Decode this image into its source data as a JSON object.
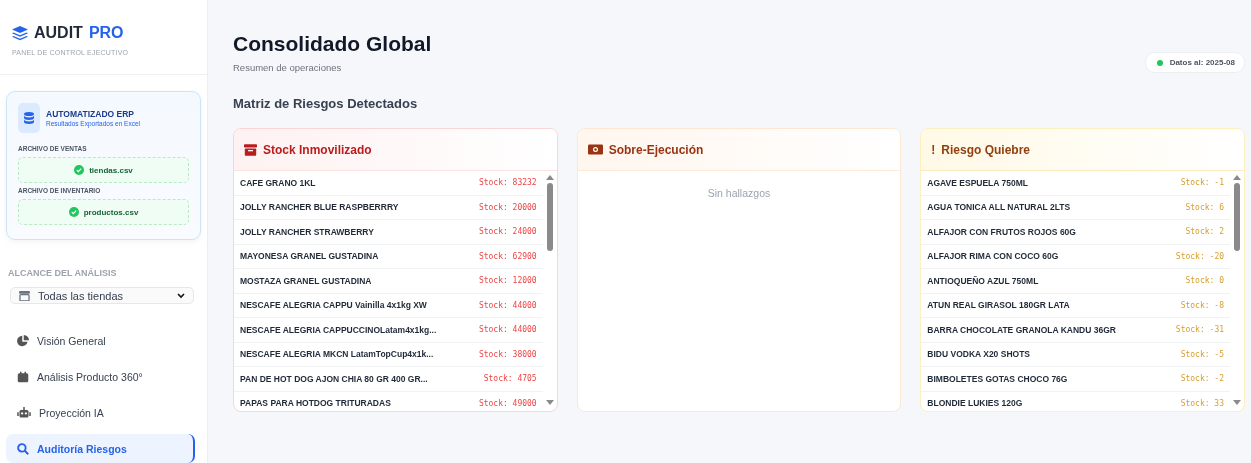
{
  "brand": {
    "name": "AUDIT",
    "accent": "PRO",
    "subtitle": "PANEL DE CONTROL EJECUTIVO"
  },
  "erp": {
    "title": "AUTOMATIZADO ERP",
    "subtitle": "Resultados Exportados en Excel",
    "files": [
      {
        "label": "ARCHIVO DE VENTAS",
        "file": "tiendas.csv"
      },
      {
        "label": "ARCHIVO DE INVENTARIO",
        "file": "productos.csv"
      }
    ]
  },
  "scope": {
    "label": "ALCANCE DEL ANÁLISIS",
    "value": "Todas las tiendas"
  },
  "nav": [
    {
      "kind": "chart",
      "label": "Visión General",
      "selected": false
    },
    {
      "kind": "calendar",
      "label": "Análisis Producto 360°",
      "selected": false
    },
    {
      "kind": "robot",
      "label": "Proyección IA",
      "selected": false
    },
    {
      "kind": "search",
      "label": "Auditoría Riesgos",
      "selected": true
    }
  ],
  "header": {
    "title": "Consolidado Global",
    "subtitle": "Resumen de operaciones",
    "badge": "Datos al: 2025-08"
  },
  "section_title": "Matriz de Riesgos Detectados",
  "panels": [
    {
      "kind": "danger",
      "title": "Stock Inmovilizado",
      "rows": [
        {
          "name": "CAFE GRANO 1KL",
          "stock": "Stock: 83232"
        },
        {
          "name": "JOLLY RANCHER BLUE RASPBERRRY",
          "stock": "Stock: 20000"
        },
        {
          "name": "JOLLY RANCHER STRAWBERRY",
          "stock": "Stock: 24000"
        },
        {
          "name": "MAYONESA GRANEL GUSTADINA",
          "stock": "Stock: 62900"
        },
        {
          "name": "MOSTAZA GRANEL GUSTADINA",
          "stock": "Stock: 12000"
        },
        {
          "name": "NESCAFE ALEGRIA CAPPU Vainilla 4x1kg XW",
          "stock": "Stock: 44000"
        },
        {
          "name": "NESCAFE ALEGRIA CAPPUCCINOLatam4x1kg...",
          "stock": "Stock: 44000"
        },
        {
          "name": "NESCAFE ALEGRIA MKCN LatamTopCup4x1k...",
          "stock": "Stock: 38000"
        },
        {
          "name": "PAN DE HOT DOG AJON CHIA 80 GR 400 GR...",
          "stock": "Stock: 4705"
        },
        {
          "name": "PAPAS PARA HOTDOG TRITURADAS",
          "stock": "Stock: 49000"
        }
      ]
    },
    {
      "kind": "cost",
      "title": "Sobre-Ejecución",
      "empty": "Sin hallazgos"
    },
    {
      "kind": "warning",
      "icon": "!",
      "title": "Riesgo Quiebre",
      "rows": [
        {
          "name": "AGAVE ESPUELA 750ML",
          "stock": "Stock: -1"
        },
        {
          "name": "AGUA TONICA ALL NATURAL 2LTS",
          "stock": "Stock: 6"
        },
        {
          "name": "ALFAJOR CON FRUTOS ROJOS 60G",
          "stock": "Stock: 2"
        },
        {
          "name": "ALFAJOR RIMA CON COCO 60G",
          "stock": "Stock: -20"
        },
        {
          "name": "ANTIOQUEÑO AZUL 750ML",
          "stock": "Stock: 0"
        },
        {
          "name": "ATUN REAL GIRASOL 180GR LATA",
          "stock": "Stock: -8"
        },
        {
          "name": "BARRA CHOCOLATE GRANOLA KANDU 36GR",
          "stock": "Stock: -31"
        },
        {
          "name": "BIDU VODKA X20 SHOTS",
          "stock": "Stock: -5"
        },
        {
          "name": "BIMBOLETES GOTAS CHOCO 76G",
          "stock": "Stock: -2"
        },
        {
          "name": "BLONDIE LUKIES 120G",
          "stock": "Stock: 33"
        }
      ]
    }
  ]
}
